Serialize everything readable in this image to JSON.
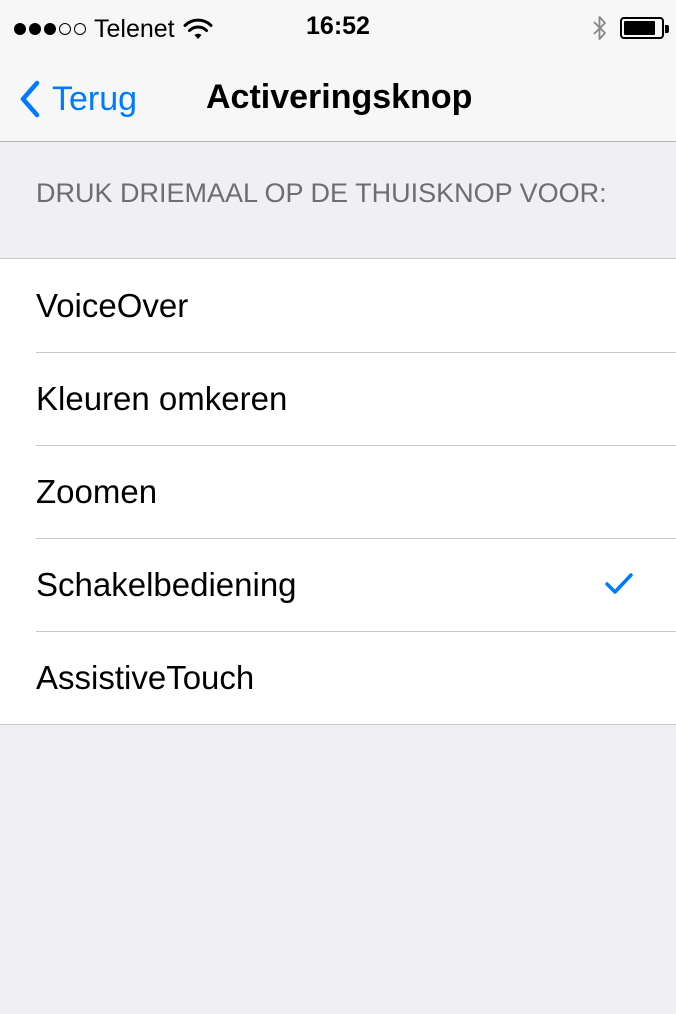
{
  "status_bar": {
    "signal_strength": 3,
    "signal_max": 5,
    "carrier": "Telenet",
    "time": "16:52",
    "battery_level": 0.85
  },
  "nav": {
    "back_label": "Terug",
    "title": "Activeringsknop"
  },
  "section": {
    "header": "DRUK DRIEMAAL OP DE THUISKNOP VOOR:"
  },
  "options": [
    {
      "label": "VoiceOver",
      "selected": false
    },
    {
      "label": "Kleuren omkeren",
      "selected": false
    },
    {
      "label": "Zoomen",
      "selected": false
    },
    {
      "label": "Schakelbediening",
      "selected": true
    },
    {
      "label": "AssistiveTouch",
      "selected": false
    }
  ],
  "colors": {
    "accent": "#007aff",
    "background": "#efeff4",
    "separator": "#c8c7cc"
  },
  "icons": {
    "back": "chevron-left-icon",
    "selected": "checkmark-icon",
    "wifi": "wifi-icon",
    "bluetooth": "bluetooth-icon",
    "battery": "battery-icon"
  }
}
